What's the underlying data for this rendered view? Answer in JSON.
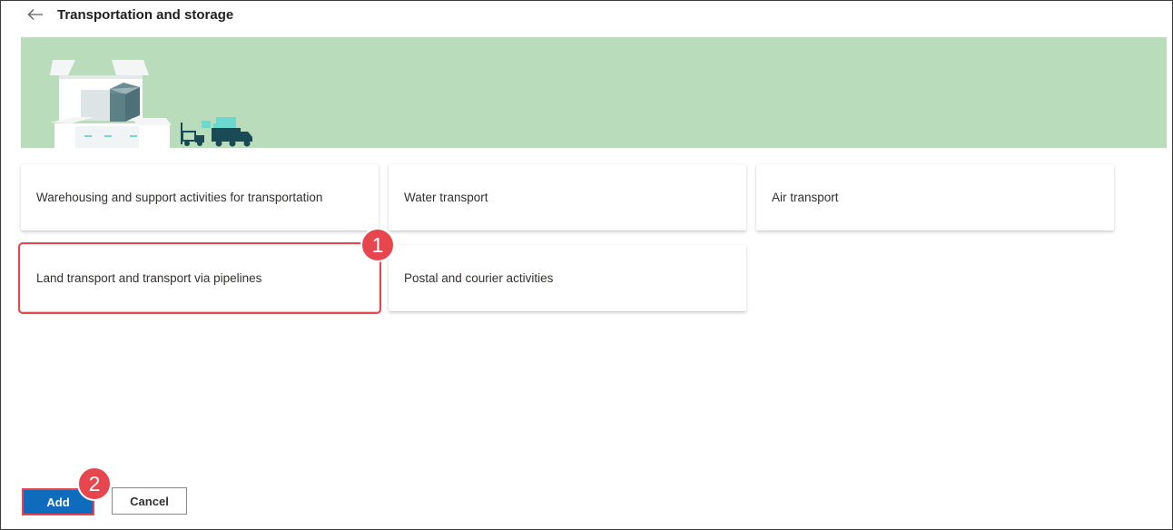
{
  "header": {
    "title": "Transportation and storage",
    "back_icon": "arrow-left-icon"
  },
  "banner": {
    "color": "#b9ddba",
    "illustration": "warehouse-and-truck-illustration"
  },
  "cards": [
    {
      "label": "Warehousing and support activities for transportation",
      "selected": false
    },
    {
      "label": "Water transport",
      "selected": false
    },
    {
      "label": "Air transport",
      "selected": false
    },
    {
      "label": "Land transport and transport via pipelines",
      "selected": true
    },
    {
      "label": "Postal and courier activities",
      "selected": false
    }
  ],
  "annotations": {
    "step1": "1",
    "step2": "2",
    "color": "#e8464e"
  },
  "footer": {
    "add_label": "Add",
    "cancel_label": "Cancel",
    "primary_color": "#0f6cbd"
  }
}
